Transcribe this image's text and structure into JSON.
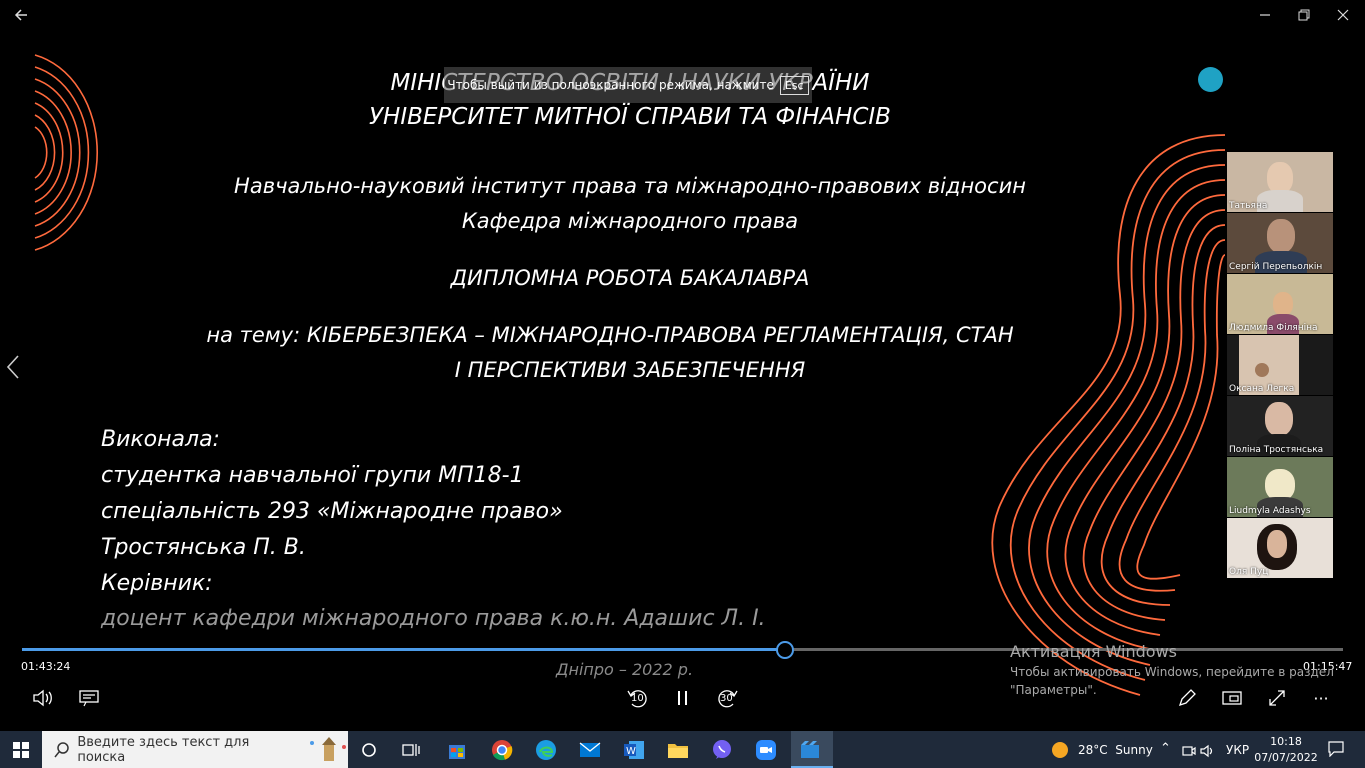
{
  "slide": {
    "title1": "МІНІСТЕРСТВО ОСВІТИ І НАУКИ УКРАЇНИ",
    "title2": "УНІВЕРСИТЕТ МИТНОЇ СПРАВИ ТА ФІНАНСІВ",
    "institute": "Навчально-науковий інститут права та міжнародно-правових відносин",
    "department": "Кафедра міжнародного права",
    "work_type": "ДИПЛОМНА РОБОТА БАКАЛАВРА",
    "topic1": "на тему: КІБЕРБЕЗПЕКА – МІЖНАРОДНО-ПРАВОВА РЕГЛАМЕНТАЦІЯ, СТАН",
    "topic2": "І ПЕРСПЕКТИВИ ЗАБЕЗПЕЧЕННЯ",
    "author_label": "Виконала:",
    "author_group": "студентка навчальної групи МП18-1",
    "author_specialty": "спеціальність 293 «Міжнародне право»",
    "author_name": "Тростянська П. В.",
    "supervisor_label": "Керівник:",
    "supervisor": "доцент кафедри міжнародного права к.ю.н. Адашис Л. І.",
    "city_year": "Дніпро – 2022 р."
  },
  "fullscreen_notice": {
    "text": "Чтобы выйти из полноэкранного режима, нажмите",
    "key": "Esc"
  },
  "participants": [
    {
      "name": "Татьяна"
    },
    {
      "name": "Сергій Перепьолкін"
    },
    {
      "name": "Людмила Філяніна"
    },
    {
      "name": "Оксана Легка"
    },
    {
      "name": "Поліна Тростянська"
    },
    {
      "name": "Liudmyla Adashys"
    },
    {
      "name": "Оля Пуц"
    }
  ],
  "player": {
    "elapsed": "01:43:24",
    "remaining": "01:15:47",
    "progress": 0.5776,
    "skip_back": "10",
    "skip_forward": "30"
  },
  "activation": {
    "title": "Активация Windows",
    "line1": "Чтобы активировать Windows, перейдите в раздел",
    "line2": "\"Параметры\"."
  },
  "taskbar": {
    "search_placeholder": "Введите здесь текст для поиска",
    "weather": "28°C  Sunny",
    "language": "УКР",
    "time": "10:18",
    "date": "07/07/2022"
  },
  "colors": {
    "accent": "#ff6a3d",
    "progress": "#4c9be8",
    "dot": "#1fa2c4"
  }
}
